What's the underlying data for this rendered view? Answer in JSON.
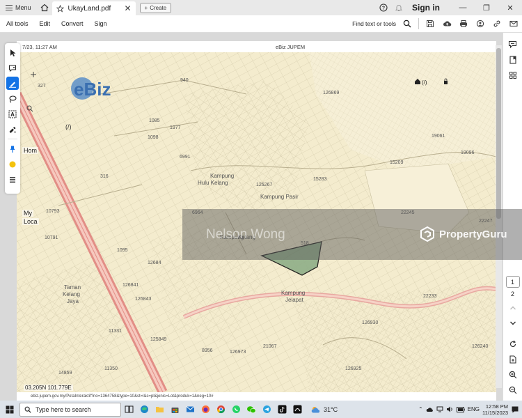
{
  "titlebar": {
    "menu_label": "Menu",
    "tab_title": "UkayLand.pdf",
    "create_label": "Create",
    "signin_label": "Sign in"
  },
  "toolbar": {
    "tabs": [
      "All tools",
      "Edit",
      "Convert",
      "Sign"
    ],
    "find_label": "Find text or tools"
  },
  "page": {
    "header_date": "7/23, 11:27 AM",
    "header_title": "eBiz JUPEM",
    "logo_text": "eBiz",
    "coords": "03.205N 101.779E",
    "footer_url": "ebiz.jupem.gov.my/PetaInteraktif?no=1364758&type=10&st=l&c=pl&jenis=Lot&produk=1&neg=10#",
    "side_home": "Hom",
    "side_my": "My",
    "side_loca": "Loca",
    "map_labels": {
      "l327": "327",
      "l940": "940",
      "l1977": "1977",
      "l1085": "1085",
      "l1098": "1098",
      "l126869": "126869",
      "l6991": "6991",
      "l126267": "126267",
      "l15283": "15283",
      "l15209": "15209",
      "l19096": "19096",
      "l19061": "19061",
      "l22245": "22245",
      "l22247": "22247",
      "l6964": "6964",
      "l10793": "10793",
      "l10791": "10791",
      "l316": "316",
      "l1095": "1095",
      "l518": "518",
      "l126841": "126841",
      "l126843": "126843",
      "l11331": "11331",
      "l125849": "125849",
      "l8956": "8956",
      "l21067": "21067",
      "l126930": "126930",
      "l126240": "126240",
      "l126925": "126925",
      "l11350": "11350",
      "l14859": "14859",
      "l22233": "22233",
      "l12684": "12684",
      "l126973": "126973",
      "slash": "(/)",
      "k1": "Kampung",
      "k1b": "Hulu Kelang",
      "k2": "Kampung Pasir",
      "k3": "Kampung",
      "k3b": "Kelang",
      "k4": "Kampung",
      "k4b": "Jelapat",
      "k5": "Taman",
      "k5b": "Kelang",
      "k5c": "Jaya",
      "home_slash": "(/)"
    }
  },
  "watermark": {
    "name": "Nelson Wong",
    "brand": "PropertyGuru"
  },
  "rpanel": {
    "page1": "1",
    "page2": "2"
  },
  "taskbar": {
    "search_placeholder": "Type here to search",
    "temperature": "31°C",
    "lang": "ENG",
    "time": "12:58 PM",
    "date": "11/15/2023"
  }
}
